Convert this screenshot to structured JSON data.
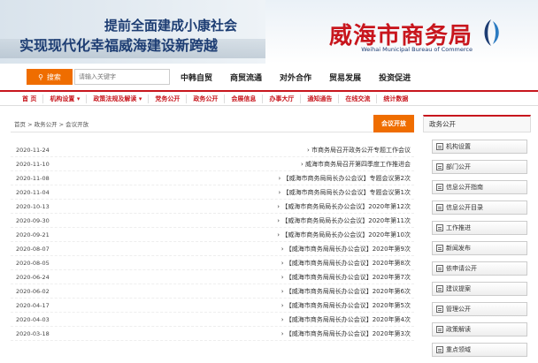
{
  "banner": {
    "slogan_line1": "提前全面建成小康社会",
    "slogan_line2": "实现现代化幸福威海建设新跨越",
    "logo_cn": "威海市商务局",
    "logo_en": "Weihai Municipal Bureau of Commerce"
  },
  "search": {
    "button_label": "搜索",
    "placeholder": "请输入关键字"
  },
  "main_nav": [
    "中韩自贸",
    "商贸流通",
    "对外合作",
    "贸易发展",
    "投资促进"
  ],
  "sub_nav": [
    "首 页",
    "机构设置 ▾",
    "政策法规及解读 ▾",
    "党务公开",
    "政务公开",
    "会展信息",
    "办事大厅",
    "通知通告",
    "在线交流",
    "统计数据"
  ],
  "breadcrumb": "首页 > 政务公开 > 会议开放",
  "crumb_tab": "会议开放",
  "list": [
    {
      "title": "› 市商务局召开政务公开专题工作会议",
      "date": "2020-11-24"
    },
    {
      "title": "› 威海市商务局召开第四季度工作推进会",
      "date": "2020-11-10"
    },
    {
      "title": "› 【威海市商务局局长办公会议】专题会议第2次",
      "date": "2020-11-08"
    },
    {
      "title": "› 【威海市商务局局长办公会议】专题会议第1次",
      "date": "2020-11-04"
    },
    {
      "title": "› 【威海市商务局局长办公会议】2020年第12次",
      "date": "2020-10-13"
    },
    {
      "title": "› 【威海市商务局局长办公会议】2020年第11次",
      "date": "2020-09-30"
    },
    {
      "title": "› 【威海市商务局局长办公会议】2020年第10次",
      "date": "2020-09-21"
    },
    {
      "title": "› 【威海市商务局局长办公会议】2020年第9次",
      "date": "2020-08-07"
    },
    {
      "title": "› 【威海市商务局局长办公会议】2020年第8次",
      "date": "2020-08-05"
    },
    {
      "title": "› 【威海市商务局局长办公会议】2020年第7次",
      "date": "2020-06-24"
    },
    {
      "title": "› 【威海市商务局局长办公会议】2020年第6次",
      "date": "2020-06-02"
    },
    {
      "title": "› 【威海市商务局局长办公会议】2020年第5次",
      "date": "2020-04-17"
    },
    {
      "title": "› 【威海市商务局局长办公会议】2020年第4次",
      "date": "2020-04-03"
    },
    {
      "title": "› 【威海市商务局局长办公会议】2020年第3次",
      "date": "2020-03-18"
    }
  ],
  "right_panel": {
    "title": "政务公开",
    "items": [
      "机构设置",
      "部门公开",
      "信息公开指南",
      "信息公开目录",
      "工作推进",
      "新闻发布",
      "依申请公开",
      "建议提案",
      "管理公开",
      "政策解读",
      "重点领域"
    ]
  },
  "colors": {
    "accent": "#c8161d",
    "orange": "#ef6d00",
    "navy": "#1d3d73"
  }
}
